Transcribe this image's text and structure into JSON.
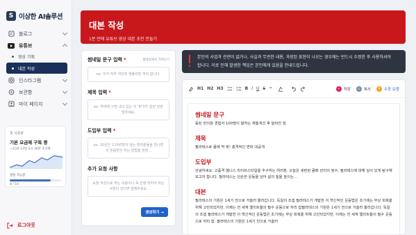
{
  "app": {
    "logo_mark": "S",
    "title": "이상한 AI솔루션"
  },
  "sidebar": {
    "items": [
      {
        "label": "블로그",
        "icon": "blog-icon"
      },
      {
        "label": "유튜브",
        "icon": "youtube-icon"
      },
      {
        "label": "인스타그램",
        "icon": "instagram-icon"
      },
      {
        "label": "보관함",
        "icon": "storage-icon"
      },
      {
        "label": "마이 페이지",
        "icon": "user-icon"
      }
    ],
    "subitems": [
      {
        "label": "영상 기획"
      },
      {
        "label": "대본 작성"
      }
    ]
  },
  "usage": {
    "label": "월 사용량",
    "plan": "기본 요금제 구독 중",
    "remaining": "~1/26 23일 2시 36분 초기화",
    "caption": "생성 가능량",
    "count": "8 / 10",
    "fill": 0.8
  },
  "logout": {
    "label": "로그아웃"
  },
  "header": {
    "title": "대본 작성",
    "subtitle": "1분 만에 유튜브 영상 대본 초안 만들기"
  },
  "form": {
    "fields": [
      {
        "label": "썸네일 문구 입력",
        "required": "*",
        "extra": "썸네일에서 가져오기",
        "placeholder": "ex. 이거 하루 하던데 영플러떤 까져 합니다."
      },
      {
        "label": "제목 입력",
        "required": "*",
        "extra": "",
        "placeholder": "ex. 하마에 구멍 내고 입는 이 '8가지' 습관 당장 멈추세요."
      },
      {
        "label": "도입부 입력",
        "required": "*",
        "extra": "",
        "placeholder": "ex. 20년간 2,000명이 넘는 환자분들을 만나면서 믿음받은 하는 방법을 한번..."
      },
      {
        "label": "추가 요청 사항",
        "required": "",
        "extra": "",
        "placeholder": "요청 작성으로 하는 내용이나 꼭 반영 되어야 하는 사항이 있다면 말해주세요."
      }
    ],
    "generate_label": "생성하기 →"
  },
  "notice": {
    "line1": "본인의 사업과 관련이 없거나, 사실과 무관한 내용, 과장된 표현이 나오는 경우에는 반드시 수정한 후 사용하셔야",
    "line2": "합니다. 이로 인해 발생한 책임은 본인에게 있음을 안내드립니다."
  },
  "toolbar": {
    "h1": "H1",
    "h2": "H2",
    "h3": "H3",
    "bold": "B",
    "italic": "I",
    "underline": "U",
    "strike": "S",
    "save_label": "저장",
    "copy_label": "복사",
    "edit_label": "수정 요청"
  },
  "doc": {
    "sections": [
      {
        "title": "썸네일 문구",
        "body": "동탄 한의원 경험자 100명이 말하는 체질개선 후 달라진 점"
      },
      {
        "title": "제목",
        "body": "필라테스로 몸에 딱 맞! 충격적인 변화 대공개"
      },
      {
        "title": "도입부",
        "body": "안녕하세요, 고품격 웰니스 라이프스타일을 추구하는 여러분. 오늘은 세련된 몸매 관리의 정수, 필라테스에 대해 깊이 있게 탐구해보고자 합니다. 필라테스는 단순한 운동을 넘어 삶의 질을 높이는..."
      },
      {
        "title": "대본",
        "body": "필라테스의 기원은 1세기 전으로 거슬러 올라갑니다. 독일의 조셉 필라테스가 개발한 이 혁신적인 운동법은 초기에는 부상 회복을 위해 고안되었지만, 이제는 전 세계 엘리트들의 필수 운동으로 자리 잡필라테스의 기원은 1세기 전으로 거슬러 올라갑니다. 독일의 조셉 필라테스가 개발한 이 혁신적인 운동법은 초기에는 부상 회복을 위해 고안되었지만, 이제는 전 세계 엘리트들의 필수 운동으로 자리 잡..필라테스의 기원은 1세기 전으로 거슬러"
      }
    ]
  },
  "colors": {
    "brand_red": "#c8181c",
    "navy": "#1a2f5a",
    "button_blue": "#1e62c9",
    "notice_bg": "#2f3540"
  }
}
